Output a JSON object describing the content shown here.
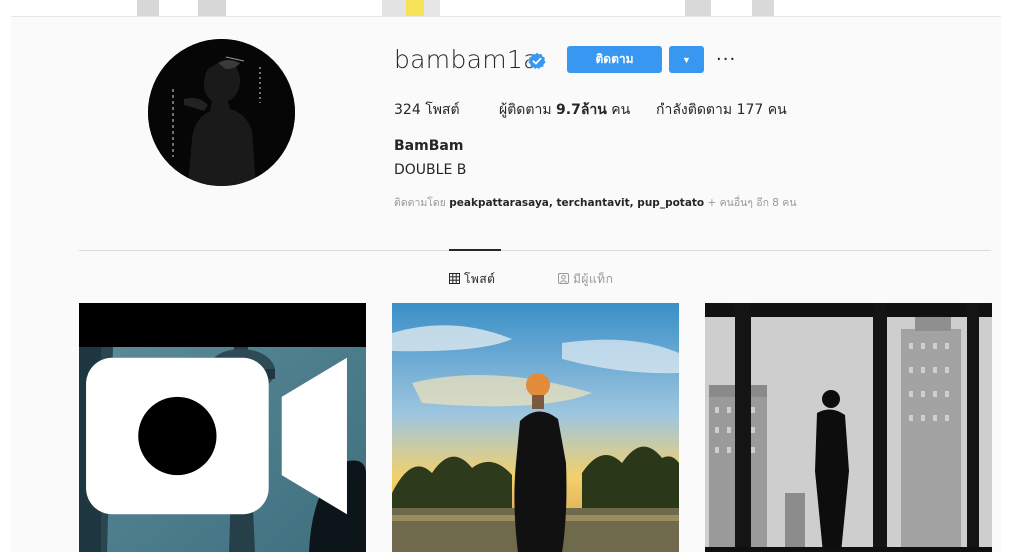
{
  "profile": {
    "username": "bambam1a",
    "follow_label": "ติดตาม",
    "more_label": "···",
    "full_name": "BamBam",
    "bio": "DOUBLE B",
    "stats": {
      "posts_count": "324",
      "posts_label": "โพสต์",
      "followers_label": "ผู้ติดตาม",
      "followers_count": "9.7ล้าน",
      "followers_unit": "คน",
      "following_label": "กำลังติดตาม",
      "following_count": "177",
      "following_unit": "คน"
    },
    "followed_by": {
      "prefix": "ติดตามโดย",
      "names": "peakpattarasaya, terchantavit, pup_potato",
      "suffix": "+ คนอื่นๆ อีก 8 คน"
    }
  },
  "tabs": [
    {
      "label": "โพสต์",
      "icon": "grid-icon",
      "active": true
    },
    {
      "label": "มีผู้แท็ก",
      "icon": "tagged-icon",
      "active": false
    }
  ],
  "posts": [
    {
      "type": "video",
      "icon": "video-icon",
      "scene": "tower"
    },
    {
      "type": "image",
      "scene": "sunset-lake"
    },
    {
      "type": "image",
      "scene": "city-window"
    }
  ],
  "colors": {
    "accent": "#3897f0",
    "verified": "#3897f0",
    "background": "#fafafa"
  }
}
